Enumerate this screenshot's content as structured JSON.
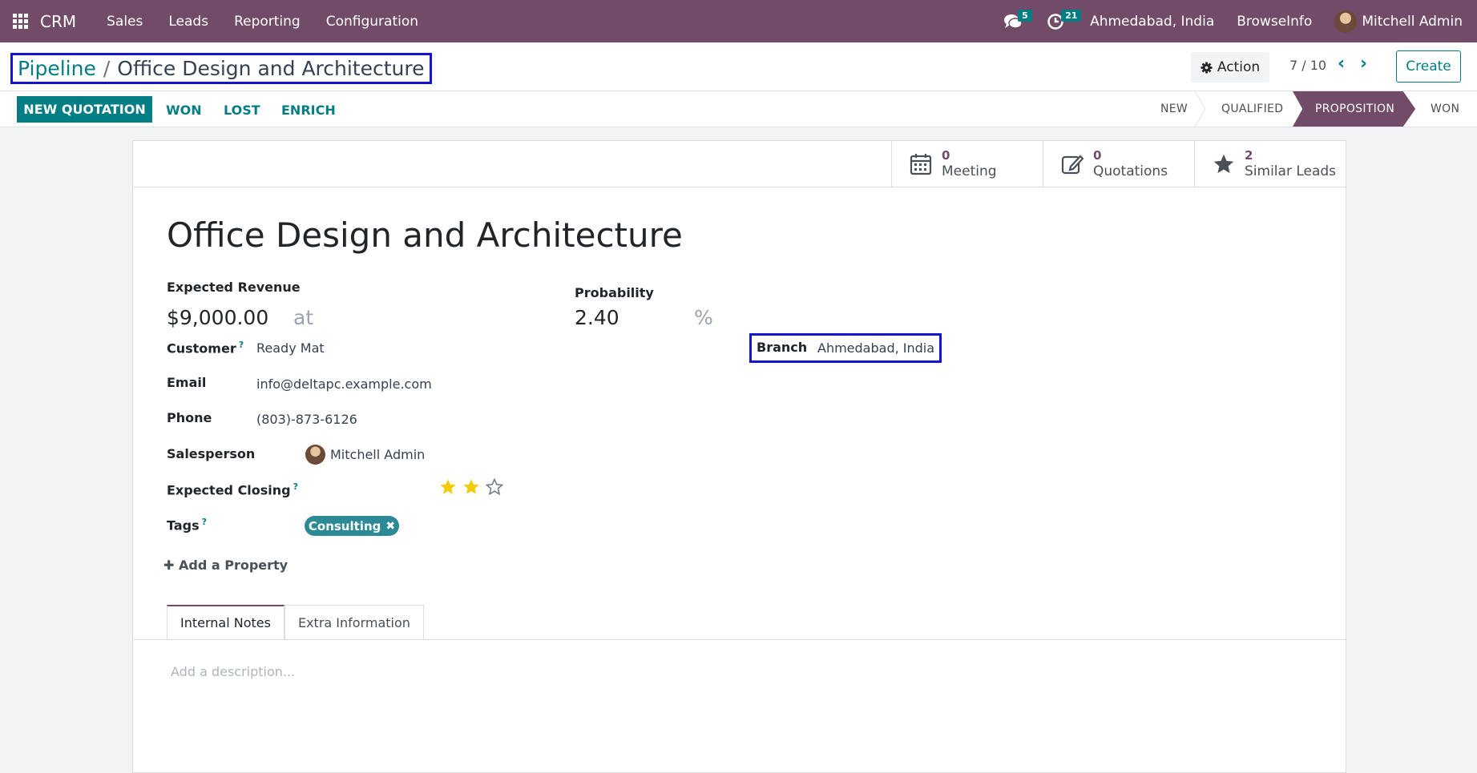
{
  "navbar": {
    "app_name": "CRM",
    "menu": [
      "Sales",
      "Leads",
      "Reporting",
      "Configuration"
    ],
    "messages_count": "5",
    "activities_count": "21",
    "branch": "Ahmedabad, India",
    "company": "BrowseInfo",
    "user": "Mitchell Admin"
  },
  "breadcrumb": {
    "parent": "Pipeline",
    "separator": "/",
    "current": "Office Design and Architecture"
  },
  "control": {
    "action_label": "Action",
    "pager": "7 / 10",
    "create_label": "Create"
  },
  "statusbar": {
    "new_quotation": "NEW QUOTATION",
    "won": "WON",
    "lost": "LOST",
    "enrich": "ENRICH",
    "stages": [
      "NEW",
      "QUALIFIED",
      "PROPOSITION",
      "WON"
    ],
    "active_stage": "PROPOSITION"
  },
  "smart_buttons": [
    {
      "value": "0",
      "label": "Meeting",
      "icon": "calendar-icon"
    },
    {
      "value": "0",
      "label": "Quotations",
      "icon": "edit-icon"
    },
    {
      "value": "2",
      "label": "Similar Leads",
      "icon": "star-icon"
    }
  ],
  "form": {
    "title": "Office Design and Architecture",
    "expected_revenue_label": "Expected Revenue",
    "expected_revenue": "$9,000.00",
    "at_label": "at",
    "probability_label": "Probability",
    "probability": "2.40",
    "percent": "%",
    "customer_label": "Customer",
    "customer": "Ready Mat",
    "email_label": "Email",
    "email": "info@deltapc.example.com",
    "phone_label": "Phone",
    "phone": "(803)-873-6126",
    "salesperson_label": "Salesperson",
    "salesperson": "Mitchell Admin",
    "expected_closing_label": "Expected Closing",
    "priority_stars": 2,
    "priority_max": 3,
    "tags_label": "Tags",
    "tag": "Consulting",
    "branch_label": "Branch",
    "branch": "Ahmedabad, India",
    "add_property": "Add a Property",
    "help_mark": "?"
  },
  "tabs": [
    "Internal Notes",
    "Extra Information"
  ],
  "description_placeholder": "Add a description...",
  "colors": {
    "brand": "#714b67",
    "accent": "#017e84",
    "highlight_box": "#1515d1",
    "star": "#f3cc00"
  }
}
